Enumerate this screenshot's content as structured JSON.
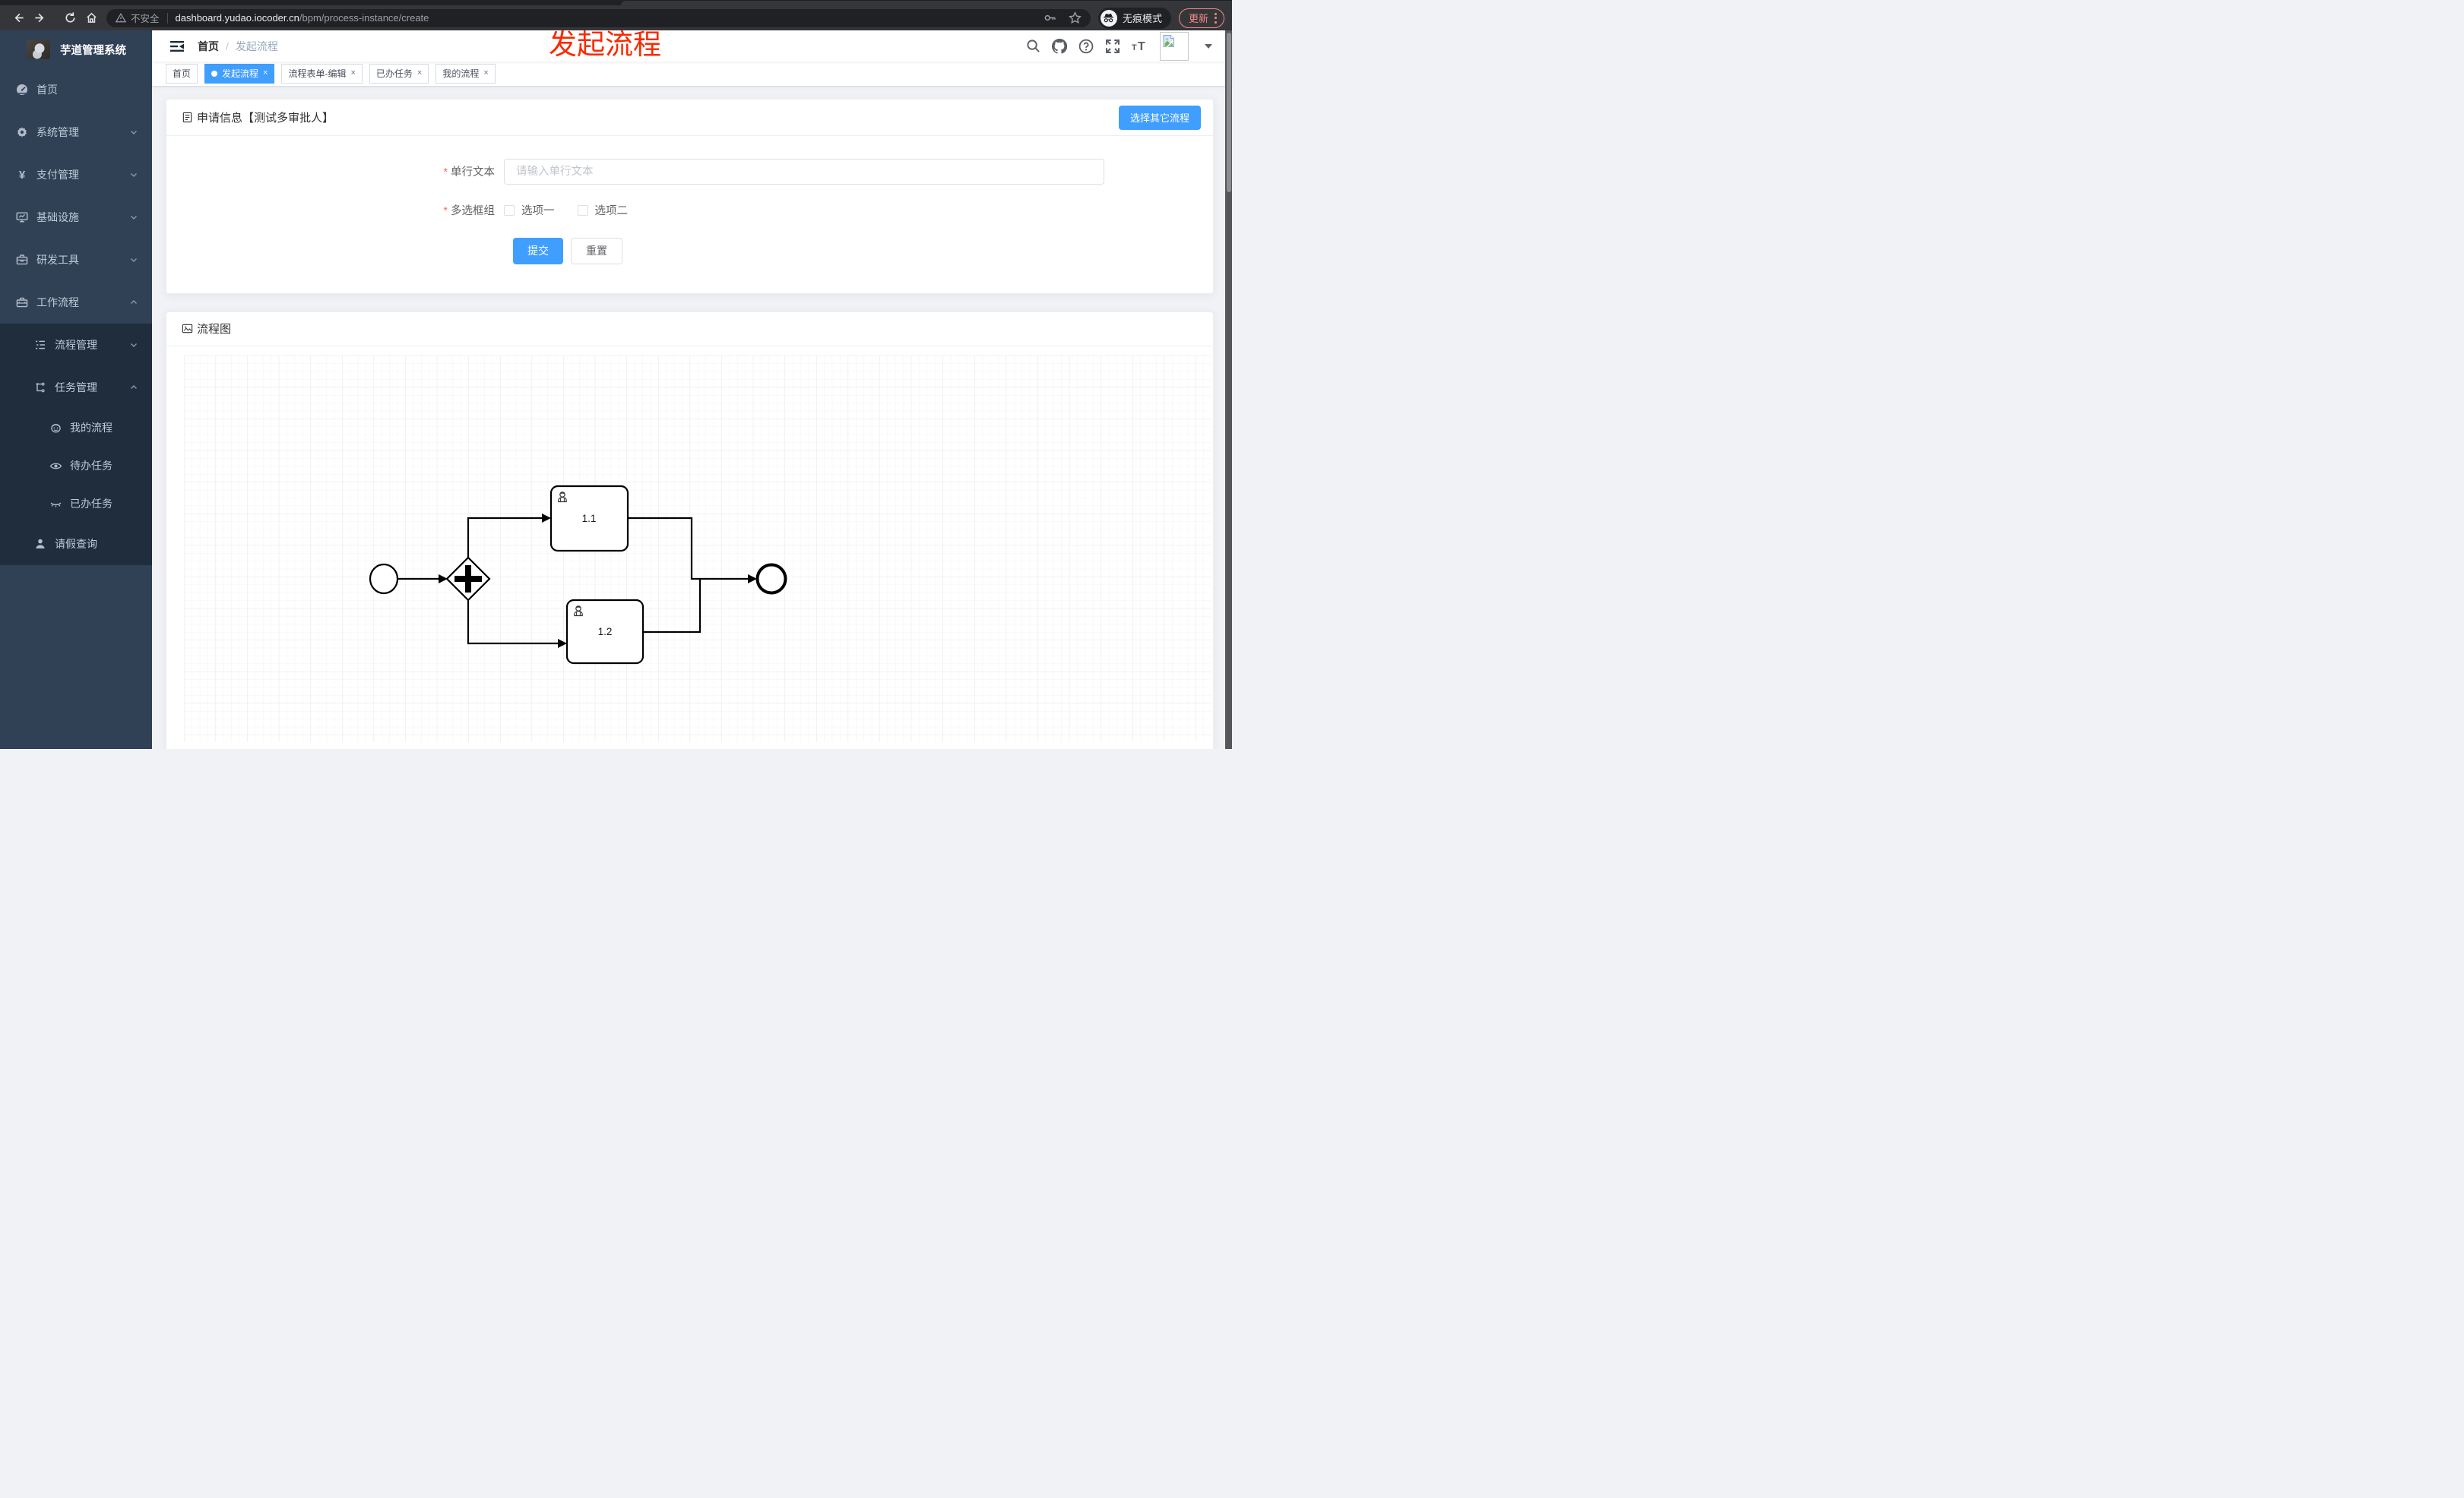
{
  "browser": {
    "security_label": "不安全",
    "url_host": "dashboard.yudao.iocoder.cn",
    "url_path": "/bpm/process-instance/create",
    "incognito_label": "无痕模式",
    "update_label": "更新"
  },
  "annotation": {
    "title": "发起流程"
  },
  "sidebar": {
    "app_title": "芋道管理系统",
    "items": [
      {
        "label": "首页"
      },
      {
        "label": "系统管理"
      },
      {
        "label": "支付管理"
      },
      {
        "label": "基础设施"
      },
      {
        "label": "研发工具"
      },
      {
        "label": "工作流程"
      },
      {
        "label": "流程管理"
      },
      {
        "label": "任务管理"
      },
      {
        "label": "我的流程"
      },
      {
        "label": "待办任务"
      },
      {
        "label": "已办任务"
      },
      {
        "label": "请假查询"
      }
    ]
  },
  "navbar": {
    "breadcrumb_home": "首页",
    "breadcrumb_separator": "/",
    "breadcrumb_current": "发起流程"
  },
  "tags": [
    {
      "label": "首页"
    },
    {
      "label": "发起流程"
    },
    {
      "label": "流程表单-编辑"
    },
    {
      "label": "已办任务"
    },
    {
      "label": "我的流程"
    }
  ],
  "tag_close_glyph": "×",
  "form_card": {
    "title": "申请信息【测试多审批人】",
    "choose_other_label": "选择其它流程",
    "required_mark": "*",
    "text_field": {
      "label": "单行文本",
      "placeholder": "请输入单行文本"
    },
    "checkbox_field": {
      "label": "多选框组",
      "options": [
        "选项一",
        "选项二"
      ]
    },
    "submit_label": "提交",
    "reset_label": "重置"
  },
  "diagram_card": {
    "title": "流程图",
    "chart": {
      "type": "bpmn-flow",
      "nodes": [
        {
          "id": "start",
          "type": "startEvent"
        },
        {
          "id": "gateway",
          "type": "parallelGateway"
        },
        {
          "id": "task1",
          "type": "userTask",
          "label": "1.1"
        },
        {
          "id": "task2",
          "type": "userTask",
          "label": "1.2"
        },
        {
          "id": "end",
          "type": "endEvent"
        }
      ],
      "edges": [
        "start -> gateway",
        "gateway -> task1",
        "gateway -> task2",
        "task1 -> end",
        "task2 -> end"
      ]
    }
  },
  "colors": {
    "accent": "#409eff",
    "sidebar_bg": "#304156",
    "submenu_bg": "#1f2d3d",
    "annotation_red": "#f82b00",
    "required_red": "#f56c6c",
    "update_pill": "#f28b82"
  }
}
